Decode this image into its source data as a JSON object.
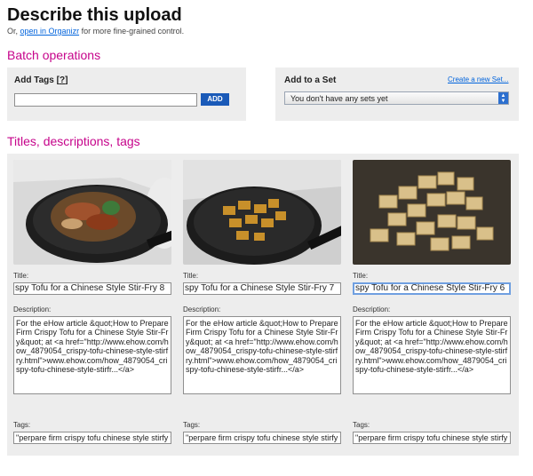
{
  "header": {
    "title": "Describe this upload",
    "subtitle_prefix": "Or,",
    "subtitle_link": "open in Organizr",
    "subtitle_suffix": "for more fine-grained control."
  },
  "batch": {
    "heading": "Batch operations",
    "add_tags_label": "Add Tags",
    "help_bracket_open": "[",
    "help_link": "?",
    "help_bracket_close": "]",
    "tag_input_value": "",
    "add_button": "ADD"
  },
  "set": {
    "label": "Add to a Set",
    "create_link": "Create a new Set...",
    "selected": "You don't have any sets yet"
  },
  "section_heading": "Titles, descriptions, tags",
  "field_labels": {
    "title": "Title:",
    "description": "Description:",
    "tags": "Tags:"
  },
  "photos": [
    {
      "title": "spy Tofu for a Chinese Style Stir-Fry 8",
      "description": "For the eHow article &quot;How to Prepare Firm Crispy Tofu for a Chinese Style Stir-Fry&quot; at <a href=\"http://www.ehow.com/how_4879054_crispy-tofu-chinese-style-stirfry.html\">www.ehow.com/how_4879054_crispy-tofu-chinese-style-stirfr...</a>",
      "tags": "\"perpare firm crispy tofu chinese style stirfy t"
    },
    {
      "title": "spy Tofu for a Chinese Style Stir-Fry 7",
      "description": "For the eHow article &quot;How to Prepare Firm Crispy Tofu for a Chinese Style Stir-Fry&quot; at <a href=\"http://www.ehow.com/how_4879054_crispy-tofu-chinese-style-stirfry.html\">www.ehow.com/how_4879054_crispy-tofu-chinese-style-stirfr...</a>",
      "tags": "\"perpare firm crispy tofu chinese style stirfy t"
    },
    {
      "title": "spy Tofu for a Chinese Style Stir-Fry 6",
      "description": "For the eHow article &quot;How to Prepare Firm Crispy Tofu for a Chinese Style Stir-Fry&quot; at <a href=\"http://www.ehow.com/how_4879054_crispy-tofu-chinese-style-stirfry.html\">www.ehow.com/how_4879054_crispy-tofu-chinese-style-stirfr...</a>",
      "tags": "\"perpare firm crispy tofu chinese style stirfy t"
    }
  ],
  "colors": {
    "heading": "#c6048b",
    "link": "#0063dc",
    "button": "#1a5ab8",
    "panel": "#ededed"
  }
}
